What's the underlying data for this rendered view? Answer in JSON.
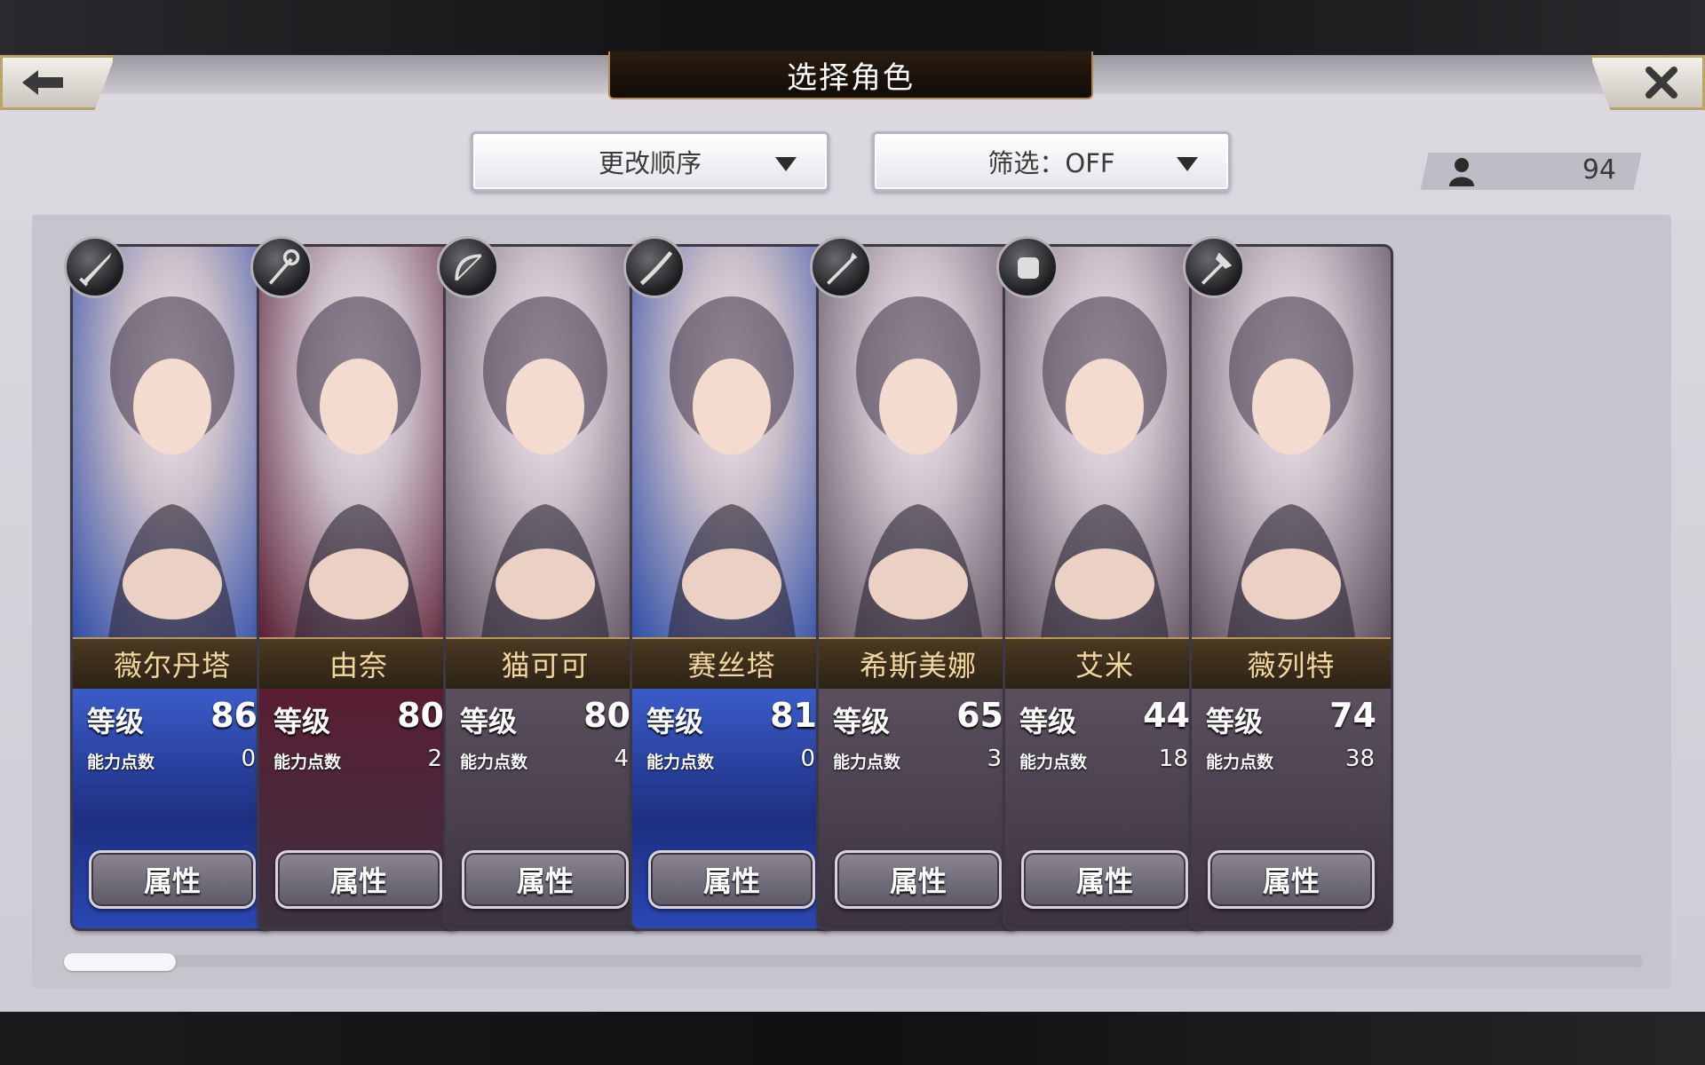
{
  "header": {
    "title": "选择角色",
    "back_icon": "arrow-left",
    "close_icon": "x"
  },
  "toolbar": {
    "sort_label": "更改顺序",
    "filter_label": "筛选：OFF",
    "character_count": "94"
  },
  "labels": {
    "level": "等级",
    "ability_points": "能力点数",
    "attribute_button": "属性"
  },
  "characters": [
    {
      "name": "薇尔丹塔",
      "level": "86",
      "ability_points": "0",
      "weapon": "sword-icon",
      "theme": "#2f4da8"
    },
    {
      "name": "由奈",
      "level": "80",
      "ability_points": "2",
      "weapon": "staff-icon",
      "theme": "#5a1d33"
    },
    {
      "name": "猫可可",
      "level": "80",
      "ability_points": "4",
      "weapon": "bow-icon",
      "theme": "#5b4f5d"
    },
    {
      "name": "赛丝塔",
      "level": "81",
      "ability_points": "0",
      "weapon": "katana-icon",
      "theme": "#2f4da8"
    },
    {
      "name": "希斯美娜",
      "level": "65",
      "ability_points": "3",
      "weapon": "spear-icon",
      "theme": "#5b4f5d"
    },
    {
      "name": "艾米",
      "level": "44",
      "ability_points": "18",
      "weapon": "gauntlet-icon",
      "theme": "#5b4f5d"
    },
    {
      "name": "薇列特",
      "level": "74",
      "ability_points": "38",
      "weapon": "axe-icon",
      "theme": "#5b4f5d"
    }
  ],
  "scroll": {
    "position": 0
  }
}
